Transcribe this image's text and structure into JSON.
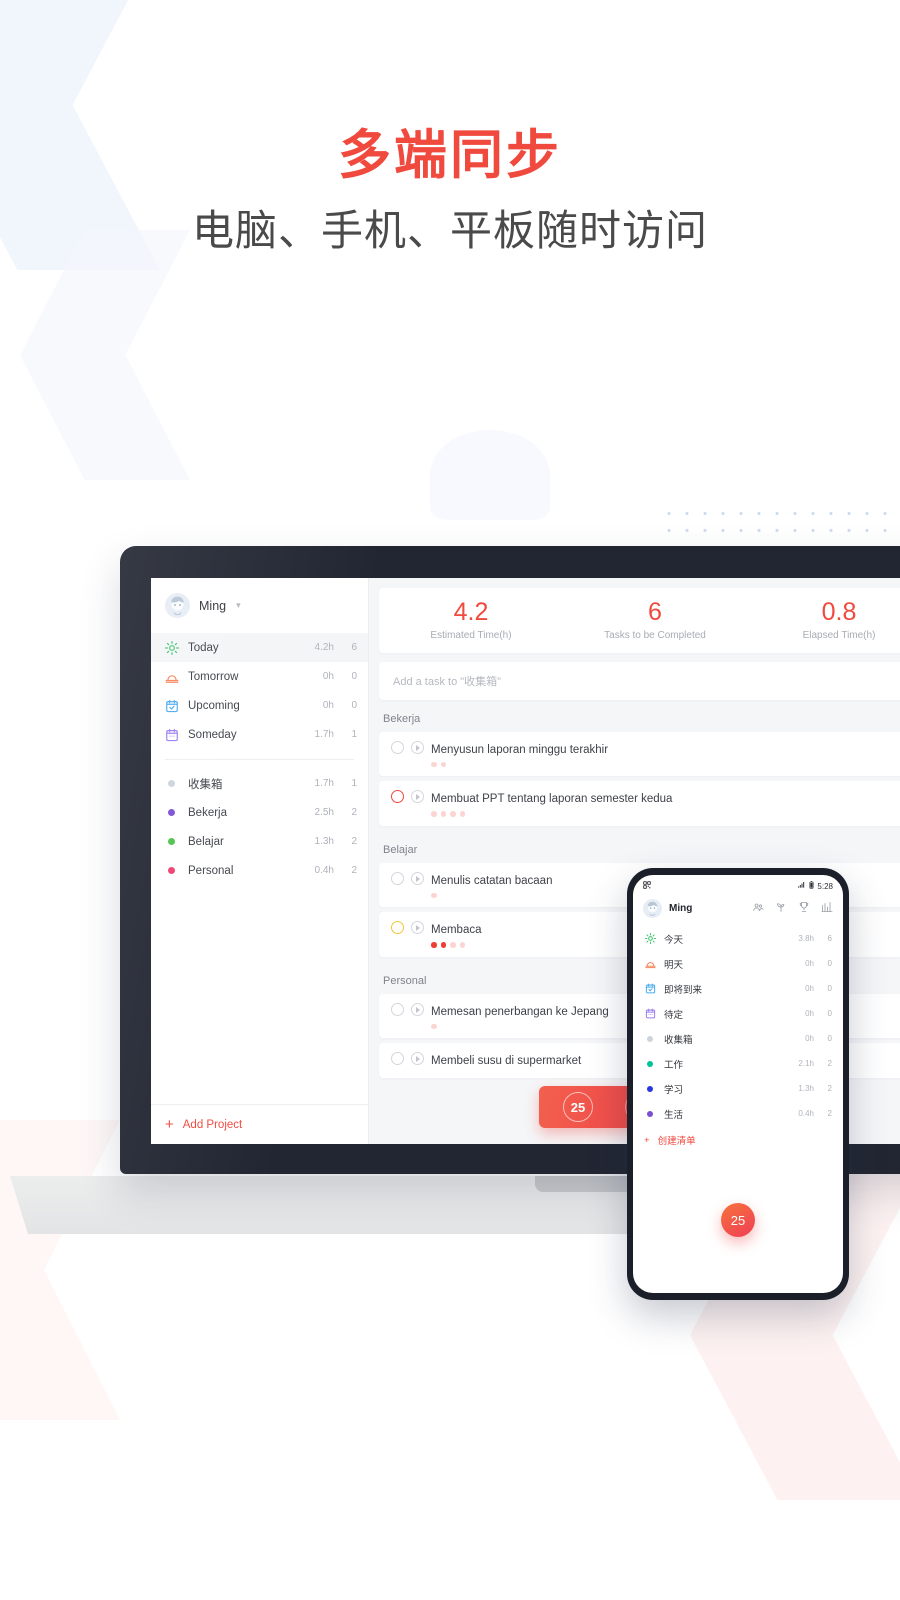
{
  "hero": {
    "title": "多端同步",
    "subtitle": "电脑、手机、平板随时访问",
    "title_color": "#f0493e",
    "subtitle_color": "#4a4a4a"
  },
  "laptop": {
    "sidebar": {
      "user": {
        "name": "Ming",
        "caret": "chevron-down-icon"
      },
      "smart_lists": [
        {
          "icon": "sun-icon",
          "label": "Today",
          "time": "4.2h",
          "count": "6",
          "active": true,
          "color": "#3ec46d"
        },
        {
          "icon": "sunrise-icon",
          "label": "Tomorrow",
          "time": "0h",
          "count": "0",
          "active": false,
          "color": "#f4845a"
        },
        {
          "icon": "calendar-check-icon",
          "label": "Upcoming",
          "time": "0h",
          "count": "0",
          "active": false,
          "color": "#4aaaf0"
        },
        {
          "icon": "calendar-icon",
          "label": "Someday",
          "time": "1.7h",
          "count": "1",
          "active": false,
          "color": "#9b7ef0"
        }
      ],
      "projects": [
        {
          "label": "收集箱",
          "time": "1.7h",
          "count": "1",
          "color": "#ccd4dc"
        },
        {
          "label": "Bekerja",
          "time": "2.5h",
          "count": "2",
          "color": "#7b4fd1"
        },
        {
          "label": "Belajar",
          "time": "1.3h",
          "count": "2",
          "color": "#4cc24a"
        },
        {
          "label": "Personal",
          "time": "0.4h",
          "count": "2",
          "color": "#ee3d6e"
        }
      ],
      "add_project": {
        "label": "Add Project",
        "icon": "plus-icon"
      }
    },
    "stats": [
      {
        "value": "4.2",
        "label": "Estimated Time(h)"
      },
      {
        "value": "6",
        "label": "Tasks to be Completed"
      },
      {
        "value": "0.8",
        "label": "Elapsed Time(h)"
      }
    ],
    "add_task_placeholder": "Add a task to \"收集箱\"",
    "groups": [
      {
        "title": "Bekerja",
        "tasks": [
          {
            "title": "Menyusun laporan minggu terakhir",
            "check": "plain",
            "tomatoes": 2,
            "filled": 0
          },
          {
            "title": "Membuat PPT tentang laporan semester kedua",
            "check": "red",
            "tomatoes": 4,
            "filled": 0
          }
        ]
      },
      {
        "title": "Belajar",
        "tasks": [
          {
            "title": "Menulis catatan bacaan",
            "check": "plain",
            "tomatoes": 1,
            "filled": 0
          },
          {
            "title": "Membaca",
            "check": "yellow",
            "tomatoes": 4,
            "filled": 2
          }
        ]
      },
      {
        "title": "Personal",
        "tasks": [
          {
            "title": "Memesan penerbangan ke Jepang",
            "check": "plain",
            "tomatoes": 1,
            "filled": 0
          },
          {
            "title": "Membeli susu di supermarket",
            "check": "plain",
            "tomatoes": 0,
            "filled": 0
          }
        ]
      }
    ],
    "timer_pill": {
      "minutes": "25",
      "play_icon": "play-icon"
    }
  },
  "phone": {
    "status": {
      "left_icon": "qr-code-icon",
      "signal": "signal-icon",
      "battery": "battery-icon",
      "time": "5:28"
    },
    "header": {
      "name": "Ming",
      "icons": [
        "people-icon",
        "sprout-icon",
        "trophy-icon",
        "chart-icon"
      ]
    },
    "smart_lists": [
      {
        "icon": "sun-icon",
        "label": "今天",
        "time": "3.8h",
        "count": "6",
        "color": "#3ec46d"
      },
      {
        "icon": "sunrise-icon",
        "label": "明天",
        "time": "0h",
        "count": "0",
        "color": "#f4845a"
      },
      {
        "icon": "calendar-check-icon",
        "label": "即将到来",
        "time": "0h",
        "count": "0",
        "color": "#4aaaf0"
      },
      {
        "icon": "calendar-icon",
        "label": "待定",
        "time": "0h",
        "count": "0",
        "color": "#9b7ef0"
      }
    ],
    "projects": [
      {
        "label": "收集箱",
        "time": "0h",
        "count": "0",
        "color": "#ccd4dc"
      },
      {
        "label": "工作",
        "time": "2.1h",
        "count": "2",
        "color": "#00c29a"
      },
      {
        "label": "学习",
        "time": "1.3h",
        "count": "2",
        "color": "#2a37e0"
      },
      {
        "label": "生活",
        "time": "0.4h",
        "count": "2",
        "color": "#7b4fd1"
      }
    ],
    "add_list": {
      "label": "创建清单",
      "icon": "plus-icon"
    },
    "fab": {
      "label": "25"
    }
  },
  "theme": {
    "accent": "#f0493e",
    "bezel": "#222632",
    "canvas": "#f5f6f8"
  }
}
